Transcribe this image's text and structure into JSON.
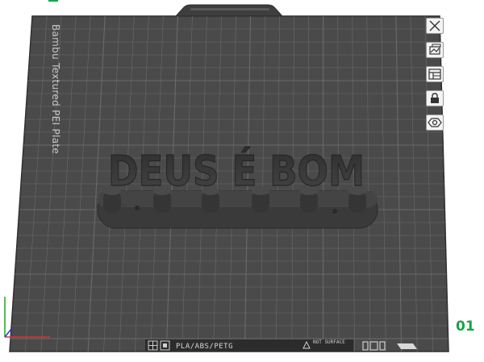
{
  "plate": {
    "name": "Bambu Textured PEI Plate",
    "number": "01",
    "filament_types": "PLA/ABS/PETG",
    "surface_note": "NOT SURFACE"
  },
  "model": {
    "text": "DEUS É BOM"
  },
  "toolbar": {
    "items": [
      {
        "name": "close-plate-button",
        "icon": "close-icon"
      },
      {
        "name": "arrange-plate-button",
        "icon": "arrange-icon"
      },
      {
        "name": "plate-layout-button",
        "icon": "layout-icon"
      },
      {
        "name": "lock-plate-button",
        "icon": "lock-icon"
      },
      {
        "name": "plate-settings-button",
        "icon": "settings-icon"
      }
    ]
  },
  "colors": {
    "plate": "#4a4a4a",
    "grid": "#6a6a6a",
    "model": "#3b3b3b",
    "accent": "#1aa34a"
  }
}
